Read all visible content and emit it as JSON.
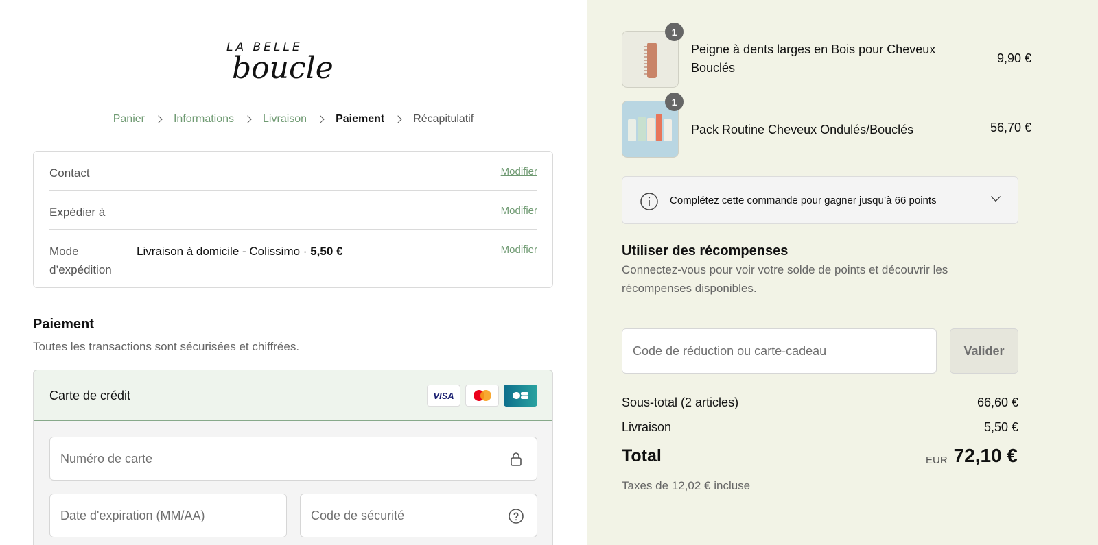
{
  "brand": {
    "line1": "LA BELLE",
    "line2": "boucle"
  },
  "breadcrumb": [
    {
      "label": "Panier",
      "state": "done"
    },
    {
      "label": "Informations",
      "state": "done"
    },
    {
      "label": "Livraison",
      "state": "done"
    },
    {
      "label": "Paiement",
      "state": "current"
    },
    {
      "label": "Récapitulatif",
      "state": "future"
    }
  ],
  "review": {
    "contact": {
      "label": "Contact",
      "value": "",
      "link": "Modifier"
    },
    "ship_to": {
      "label": "Expédier à",
      "value": "",
      "link": "Modifier"
    },
    "method": {
      "label_line1": "Mode",
      "label_line2": "d’expédition",
      "value": "Livraison à domicile - Colissimo · ",
      "price": "5,50 €",
      "link": "Modifier"
    }
  },
  "payment": {
    "title": "Paiement",
    "subtitle": "Toutes les transactions sont sécurisées et chiffrées.",
    "method_label": "Carte de crédit",
    "card_brands": [
      "VISA",
      "Mastercard",
      "CB"
    ],
    "card_number_placeholder": "Numéro de carte",
    "expiry_placeholder": "Date d'expiration (MM/AA)",
    "cvc_placeholder": "Code de sécurité"
  },
  "cart": {
    "items": [
      {
        "name": "Peigne à dents larges en Bois pour Cheveux Bouclés",
        "price": "9,90 €",
        "qty": "1"
      },
      {
        "name": "Pack Routine Cheveux Ondulés/Bouclés",
        "price": "56,70 €",
        "qty": "1"
      }
    ]
  },
  "points": {
    "text": "Complétez cette commande pour gagner jusqu’à 66 points"
  },
  "rewards": {
    "title": "Utiliser des récompenses",
    "subtitle": "Connectez-vous pour voir votre solde de points et découvrir les récompenses disponibles."
  },
  "discount": {
    "placeholder": "Code de réduction ou carte-cadeau",
    "button": "Valider"
  },
  "totals": {
    "subtotal_label": "Sous-total (2 articles)",
    "subtotal": "66,60 €",
    "shipping_label": "Livraison",
    "shipping": "5,50 €",
    "total_label": "Total",
    "currency": "EUR",
    "total": "72,10 €",
    "taxes": "Taxes de 12,02 € incluse"
  },
  "colors": {
    "accent": "#6f9a72",
    "right_bg": "#f2f3e6",
    "selected_bg": "#eef4ed"
  }
}
